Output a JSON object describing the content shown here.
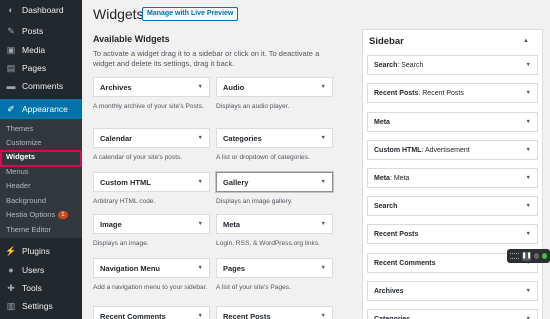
{
  "sidebar": {
    "top_items": [
      {
        "label": "Dashboard",
        "icon": "dashboard-icon"
      },
      {
        "label": "Posts",
        "icon": "pushpin-icon"
      },
      {
        "label": "Media",
        "icon": "media-icon"
      },
      {
        "label": "Pages",
        "icon": "pages-icon"
      },
      {
        "label": "Comments",
        "icon": "comments-icon"
      }
    ],
    "active": {
      "label": "Appearance",
      "icon": "brush-icon"
    },
    "submenu": [
      "Themes",
      "Customize",
      "Widgets",
      "Menus",
      "Header",
      "Background",
      "Hestia Options",
      "Theme Editor"
    ],
    "hestia_badge": "1",
    "bottom_items": [
      {
        "label": "Plugins",
        "icon": "plugin-icon"
      },
      {
        "label": "Users",
        "icon": "users-icon"
      },
      {
        "label": "Tools",
        "icon": "wrench-icon"
      },
      {
        "label": "Settings",
        "icon": "settings-icon"
      }
    ],
    "accent_color": "#0073aa",
    "highlight_color": "#d0104c"
  },
  "header": {
    "title": "Widgets",
    "live_preview_label": "Manage with Live Preview"
  },
  "available": {
    "title": "Available Widgets",
    "description": "To activate a widget drag it to a sidebar or click on it. To deactivate a widget and delete its settings, drag it back.",
    "widgets": [
      {
        "name": "Archives",
        "desc": "A monthly archive of your site's Posts."
      },
      {
        "name": "Audio",
        "desc": "Displays an audio player."
      },
      {
        "name": "Calendar",
        "desc": "A calendar of your site's posts."
      },
      {
        "name": "Categories",
        "desc": "A list or dropdown of categories."
      },
      {
        "name": "Custom HTML",
        "desc": "Arbitrary HTML code."
      },
      {
        "name": "Gallery",
        "desc": "Displays an image gallery."
      },
      {
        "name": "Image",
        "desc": "Displays an image."
      },
      {
        "name": "Meta",
        "desc": "Login, RSS, & WordPress.org links."
      },
      {
        "name": "Navigation Menu",
        "desc": "Add a navigation menu to your sidebar."
      },
      {
        "name": "Pages",
        "desc": "A list of your site's Pages."
      },
      {
        "name": "Recent Comments",
        "desc": ""
      },
      {
        "name": "Recent Posts",
        "desc": ""
      }
    ]
  },
  "sidebar_area": {
    "title": "Sidebar",
    "widgets": [
      {
        "type": "Search",
        "title": "Search"
      },
      {
        "type": "Recent Posts",
        "title": "Recent Posts"
      },
      {
        "type": "Meta",
        "title": ""
      },
      {
        "type": "Custom HTML",
        "title": "Advertisement"
      },
      {
        "type": "Meta",
        "title": "Meta"
      },
      {
        "type": "Search",
        "title": ""
      },
      {
        "type": "Recent Posts",
        "title": ""
      },
      {
        "type": "Recent Comments",
        "title": ""
      },
      {
        "type": "Archives",
        "title": ""
      },
      {
        "type": "Categories",
        "title": ""
      }
    ]
  },
  "media_control": {
    "icon": "pause-icon"
  }
}
